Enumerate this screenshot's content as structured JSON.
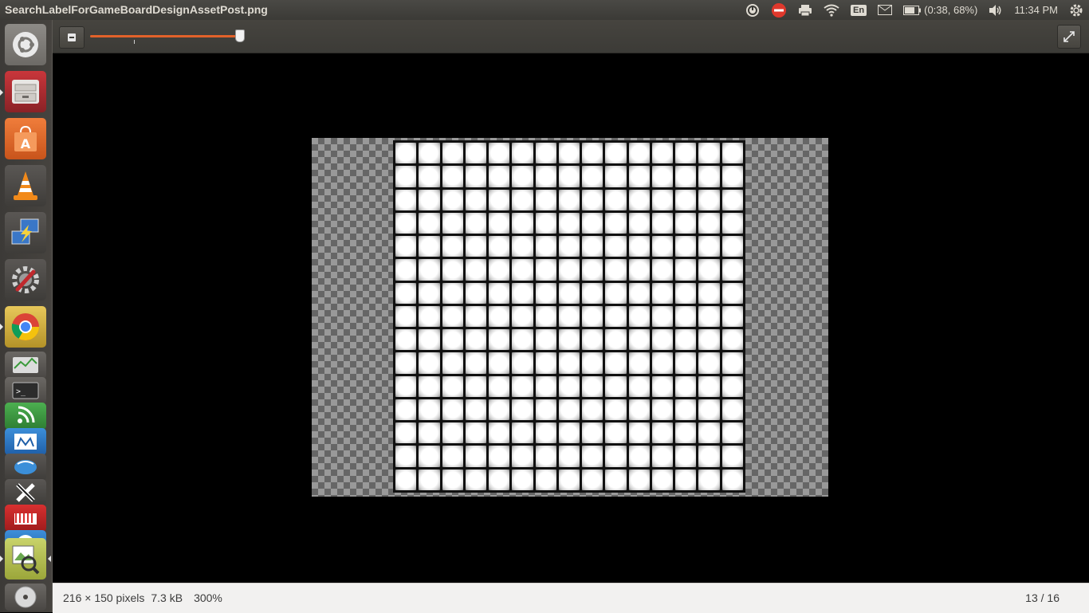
{
  "window": {
    "title": "SearchLabelForGameBoardDesignAssetPost.png"
  },
  "indicators": {
    "keyboard_layout": "En",
    "battery": "(0:38, 68%)",
    "clock": "11:34 PM"
  },
  "launcher": {
    "items": [
      {
        "name": "dash-home-icon"
      },
      {
        "name": "file-manager-icon"
      },
      {
        "name": "software-center-icon"
      },
      {
        "name": "vlc-icon"
      },
      {
        "name": "remote-desktop-icon"
      },
      {
        "name": "system-settings-icon"
      },
      {
        "name": "chrome-icon"
      },
      {
        "name": "system-monitor-icon"
      },
      {
        "name": "terminal-icon"
      },
      {
        "name": "rss-reader-icon"
      },
      {
        "name": "calendar-icon"
      },
      {
        "name": "mail-client-icon"
      },
      {
        "name": "xchat-icon"
      },
      {
        "name": "bookmarks-icon"
      },
      {
        "name": "teamviewer-icon"
      },
      {
        "name": "image-viewer-icon"
      },
      {
        "name": "disc-icon"
      }
    ]
  },
  "viewer": {
    "zoom_level_fraction": 0.97,
    "board": {
      "rows": 15,
      "columns": 15
    }
  },
  "status": {
    "dimensions": "216 × 150 pixels",
    "filesize": "7.3 kB",
    "zoom": "300%",
    "position": "13 / 16"
  },
  "colors": {
    "panel": "#3b3a36",
    "slider_accent": "#e2622a",
    "statusbar": "#f2f1f0"
  }
}
